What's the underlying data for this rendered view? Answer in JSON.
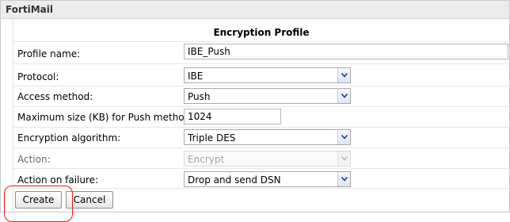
{
  "window": {
    "title": "FortiMail"
  },
  "form": {
    "title": "Encryption Profile",
    "fields": {
      "profile_name": {
        "label": "Profile name:",
        "value": "IBE_Push"
      },
      "protocol": {
        "label": "Protocol:",
        "value": "IBE"
      },
      "access_method": {
        "label": "Access method:",
        "value": "Push"
      },
      "max_size": {
        "label": "Maximum size (KB) for Push method:",
        "value": "1024"
      },
      "encryption_algorithm": {
        "label": "Encryption algorithm:",
        "value": "Triple DES"
      },
      "action": {
        "label": "Action:",
        "value": "Encrypt",
        "disabled": true
      },
      "action_on_failure": {
        "label": "Action on failure:",
        "value": "Drop and send DSN"
      }
    }
  },
  "buttons": {
    "create": "Create",
    "cancel": "Cancel"
  },
  "colors": {
    "annotation": "#e31b1b",
    "titlebar": "#ececec",
    "select_arrow": "#1f3e8a"
  }
}
